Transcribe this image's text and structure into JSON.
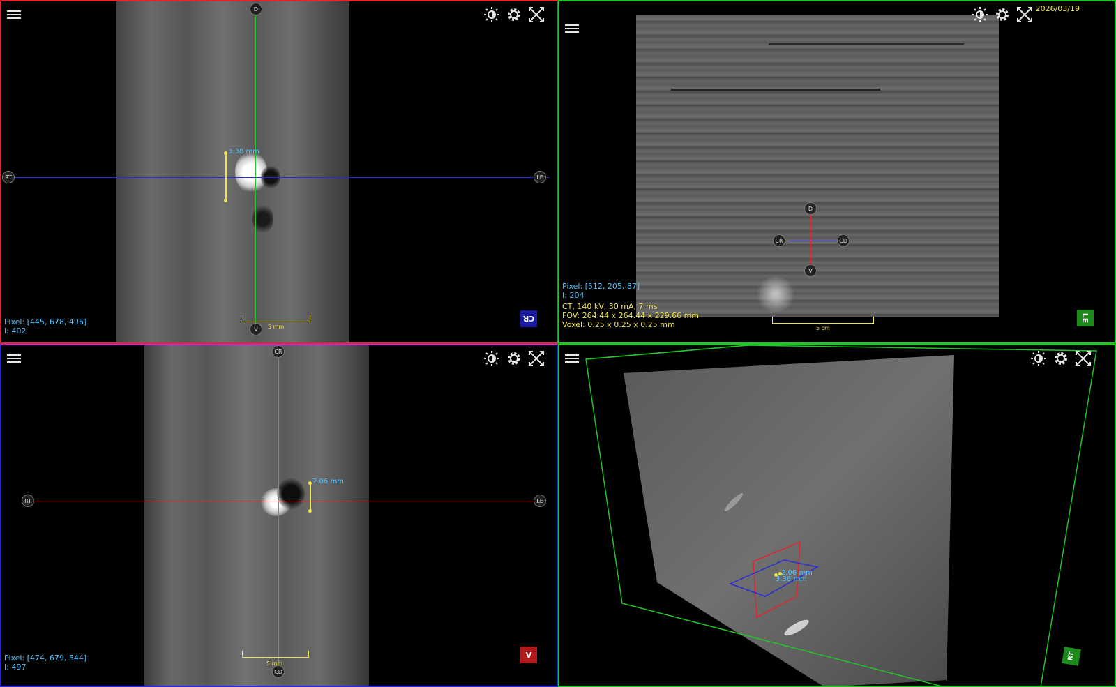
{
  "date": "2026/03/19",
  "viewports": {
    "tl": {
      "markers": {
        "top": "D",
        "bottom": "V",
        "left": "RT",
        "right": "LE"
      },
      "measurement": "3.38 mm",
      "scale_label": "5 mm",
      "pixel": "Pixel: [445, 678, 496]",
      "intensity": "I: 402",
      "orientation": "CR",
      "orientation_color": "#1a1aa0"
    },
    "tr": {
      "markers": {
        "top": "D",
        "bottom": "V",
        "left": "CR",
        "right": "CD"
      },
      "scale_label": "5 cm",
      "pixel": "Pixel: [512, 205, 87]",
      "intensity": "I: 204",
      "ct": "CT, 140 kV, 30 mA, 7 ms",
      "fov": "FOV: 264.44 x 264.44 x 229.66 mm",
      "voxel": "Voxel: 0.25 x 0.25 x 0.25 mm",
      "orientation": "LE",
      "orientation_color": "#1b8a1b"
    },
    "bl": {
      "markers": {
        "top": "CR",
        "bottom": "CD",
        "left": "RT",
        "right": "LE"
      },
      "measurement": "2.06 mm",
      "scale_label": "5 mm",
      "pixel": "Pixel: [474, 679, 544]",
      "intensity": "I: 497",
      "orientation": "V",
      "orientation_color": "#b01a1a"
    },
    "br": {
      "measurement_a": "2.06 mm",
      "measurement_b": "3.38 mm",
      "orientation": "RT",
      "orientation_color": "#1b8a1b"
    }
  },
  "icons": [
    "menu-icon",
    "contrast-icon",
    "gear-icon",
    "fullscreen-icon"
  ],
  "colors": {
    "cyan": "#4ec3ff",
    "yellow": "#f0e34a",
    "red": "#e0272f",
    "green": "#22c52a",
    "blue": "#2a2ad8"
  }
}
